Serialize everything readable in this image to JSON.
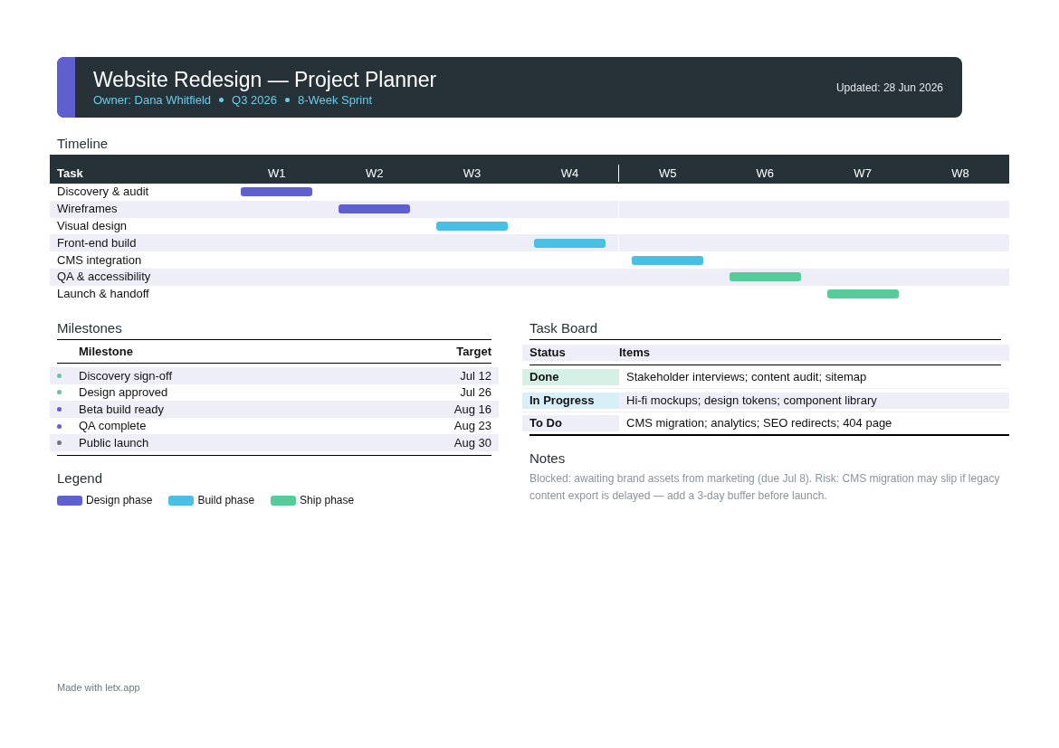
{
  "header": {
    "title": "Website Redesign — Project Planner",
    "subtitle": [
      "Owner: Dana Whitfield",
      "Q3 2026",
      "8-Week Sprint"
    ],
    "updated": "Updated: 28 Jun 2026"
  },
  "timeline": {
    "title": "Timeline",
    "task_heading": "Task",
    "weeks": [
      "W1",
      "W2",
      "W3",
      "W4",
      "W5",
      "W6",
      "W7",
      "W8"
    ],
    "tasks": [
      {
        "name": "Discovery & audit",
        "color": "#5f5fd0"
      },
      {
        "name": "Wireframes",
        "color": "#5f5fd0"
      },
      {
        "name": "Visual design",
        "color": "#48bfe3"
      },
      {
        "name": "Front-end build",
        "color": "#48bfe3"
      },
      {
        "name": "CMS integration",
        "color": "#48bfe3"
      },
      {
        "name": "QA & accessibility",
        "color": "#56cc9a"
      },
      {
        "name": "Launch & handoff",
        "color": "#56cc9a"
      }
    ]
  },
  "milestones": {
    "title": "Milestones",
    "columns": [
      "Milestone",
      "Target"
    ],
    "rows": [
      {
        "name": "Discovery sign-off",
        "target": "Jul 12",
        "color": "#57cc99"
      },
      {
        "name": "Design approved",
        "target": "Jul 26",
        "color": "#57cc99"
      },
      {
        "name": "Beta build ready",
        "target": "Aug 16",
        "color": "#5f5fd0"
      },
      {
        "name": "QA complete",
        "target": "Aug 23",
        "color": "#5f5fd0"
      },
      {
        "name": "Public launch",
        "target": "Aug 30",
        "color": "#6b7780"
      }
    ]
  },
  "legend": {
    "title": "Legend",
    "items": [
      {
        "label": "Design phase",
        "color": "#5f5fd0"
      },
      {
        "label": "Build phase",
        "color": "#48bfe3"
      },
      {
        "label": "Ship phase",
        "color": "#56cc9a"
      }
    ]
  },
  "task_board": {
    "title": "Task Board",
    "columns": [
      "Status",
      "Items"
    ],
    "rows": [
      {
        "status": "Done",
        "items": "Stakeholder interviews; content audit; sitemap",
        "color": "#d5f1e5"
      },
      {
        "status": "In Progress",
        "items": "Hi-fi mockups; design tokens; component library",
        "color": "#d7f0f8"
      },
      {
        "status": "To Do",
        "items": "CMS migration; analytics; SEO redirects; 404 page",
        "color": "#eeeef8"
      }
    ]
  },
  "notes": {
    "title": "Notes",
    "text": "Blocked: awaiting brand assets from marketing (due Jul 8). Risk: CMS migration may slip if legacy content export is delayed — add a 3-day buffer before launch."
  },
  "footer": "Made with letx.app"
}
